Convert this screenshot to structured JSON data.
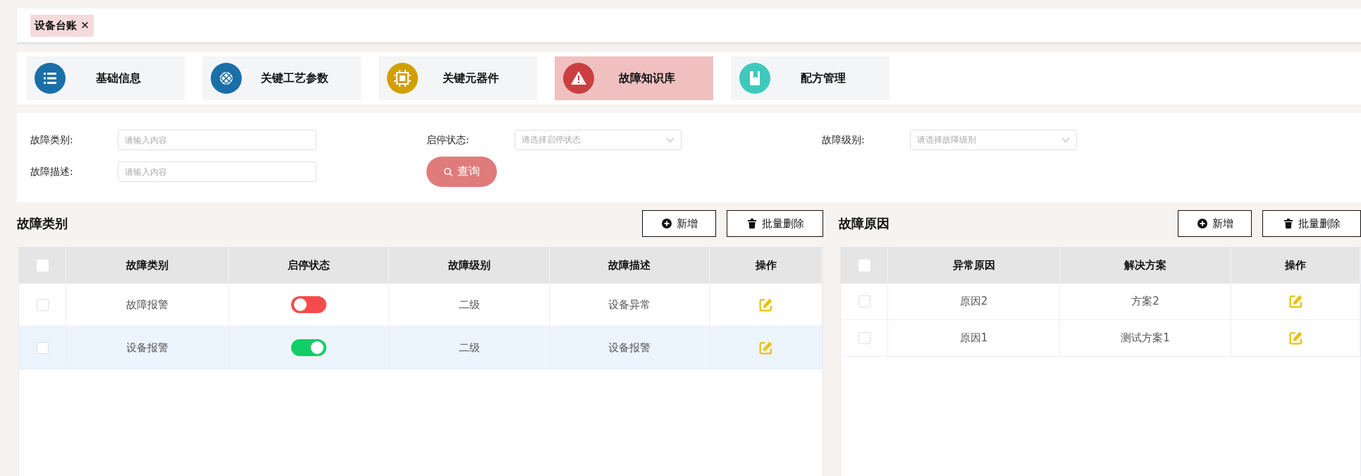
{
  "tags": [
    {
      "label": "设备台账",
      "close": "✕",
      "selected": true
    }
  ],
  "modules": [
    {
      "label": "基础信息",
      "color": "#1a6fa8",
      "selected": false
    },
    {
      "label": "关键工艺参数",
      "color": "#1a6fa8",
      "selected": false
    },
    {
      "label": "关键元器件",
      "color": "#d1a000",
      "selected": false
    },
    {
      "label": "故障知识库",
      "color": "#c94040",
      "selected": true
    },
    {
      "label": "配方管理",
      "color": "#3ec9bd",
      "selected": false
    }
  ],
  "filters": {
    "category": {
      "label": "故障类别:",
      "placeholder": "请输入内容"
    },
    "status": {
      "label": "启停状态:",
      "placeholder": "请选择启停状态"
    },
    "level": {
      "label": "故障级别:",
      "placeholder": "请选择故障级别"
    },
    "description": {
      "label": "故障描述:",
      "placeholder": "请输入内容"
    },
    "search_button": "查询"
  },
  "left_panel": {
    "title": "故障类别",
    "add_button": "新增",
    "delete_button": "批量删除",
    "select_all_checked": false,
    "columns": [
      "故障类别",
      "启停状态",
      "故障级别",
      "故障描述",
      "操作"
    ],
    "rows": [
      {
        "category": "故障报警",
        "on": false,
        "level": "二级",
        "description": "设备异常",
        "selected": false,
        "highlighted": false
      },
      {
        "category": "设备报警",
        "on": true,
        "level": "二级",
        "description": "设备报警",
        "selected": false,
        "highlighted": true
      }
    ]
  },
  "right_panel": {
    "title": "故障原因",
    "add_button": "新增",
    "delete_button": "批量删除",
    "select_all_checked": false,
    "columns": [
      "异常原因",
      "解决方案",
      "操作"
    ],
    "rows": [
      {
        "cause": "原因2",
        "solution": "方案2",
        "selected": false
      },
      {
        "cause": "原因1",
        "solution": "测试方案1",
        "selected": false
      }
    ]
  }
}
